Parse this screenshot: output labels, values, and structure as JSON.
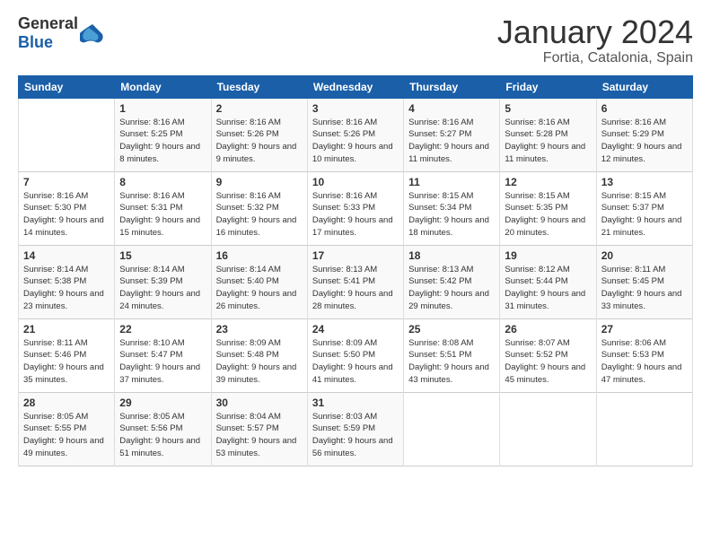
{
  "logo": {
    "general": "General",
    "blue": "Blue"
  },
  "header": {
    "month": "January 2024",
    "location": "Fortia, Catalonia, Spain"
  },
  "weekdays": [
    "Sunday",
    "Monday",
    "Tuesday",
    "Wednesday",
    "Thursday",
    "Friday",
    "Saturday"
  ],
  "weeks": [
    [
      {
        "day": "",
        "sunrise": "",
        "sunset": "",
        "daylight": ""
      },
      {
        "day": "1",
        "sunrise": "Sunrise: 8:16 AM",
        "sunset": "Sunset: 5:25 PM",
        "daylight": "Daylight: 9 hours and 8 minutes."
      },
      {
        "day": "2",
        "sunrise": "Sunrise: 8:16 AM",
        "sunset": "Sunset: 5:26 PM",
        "daylight": "Daylight: 9 hours and 9 minutes."
      },
      {
        "day": "3",
        "sunrise": "Sunrise: 8:16 AM",
        "sunset": "Sunset: 5:26 PM",
        "daylight": "Daylight: 9 hours and 10 minutes."
      },
      {
        "day": "4",
        "sunrise": "Sunrise: 8:16 AM",
        "sunset": "Sunset: 5:27 PM",
        "daylight": "Daylight: 9 hours and 11 minutes."
      },
      {
        "day": "5",
        "sunrise": "Sunrise: 8:16 AM",
        "sunset": "Sunset: 5:28 PM",
        "daylight": "Daylight: 9 hours and 11 minutes."
      },
      {
        "day": "6",
        "sunrise": "Sunrise: 8:16 AM",
        "sunset": "Sunset: 5:29 PM",
        "daylight": "Daylight: 9 hours and 12 minutes."
      }
    ],
    [
      {
        "day": "7",
        "sunrise": "Sunrise: 8:16 AM",
        "sunset": "Sunset: 5:30 PM",
        "daylight": "Daylight: 9 hours and 14 minutes."
      },
      {
        "day": "8",
        "sunrise": "Sunrise: 8:16 AM",
        "sunset": "Sunset: 5:31 PM",
        "daylight": "Daylight: 9 hours and 15 minutes."
      },
      {
        "day": "9",
        "sunrise": "Sunrise: 8:16 AM",
        "sunset": "Sunset: 5:32 PM",
        "daylight": "Daylight: 9 hours and 16 minutes."
      },
      {
        "day": "10",
        "sunrise": "Sunrise: 8:16 AM",
        "sunset": "Sunset: 5:33 PM",
        "daylight": "Daylight: 9 hours and 17 minutes."
      },
      {
        "day": "11",
        "sunrise": "Sunrise: 8:15 AM",
        "sunset": "Sunset: 5:34 PM",
        "daylight": "Daylight: 9 hours and 18 minutes."
      },
      {
        "day": "12",
        "sunrise": "Sunrise: 8:15 AM",
        "sunset": "Sunset: 5:35 PM",
        "daylight": "Daylight: 9 hours and 20 minutes."
      },
      {
        "day": "13",
        "sunrise": "Sunrise: 8:15 AM",
        "sunset": "Sunset: 5:37 PM",
        "daylight": "Daylight: 9 hours and 21 minutes."
      }
    ],
    [
      {
        "day": "14",
        "sunrise": "Sunrise: 8:14 AM",
        "sunset": "Sunset: 5:38 PM",
        "daylight": "Daylight: 9 hours and 23 minutes."
      },
      {
        "day": "15",
        "sunrise": "Sunrise: 8:14 AM",
        "sunset": "Sunset: 5:39 PM",
        "daylight": "Daylight: 9 hours and 24 minutes."
      },
      {
        "day": "16",
        "sunrise": "Sunrise: 8:14 AM",
        "sunset": "Sunset: 5:40 PM",
        "daylight": "Daylight: 9 hours and 26 minutes."
      },
      {
        "day": "17",
        "sunrise": "Sunrise: 8:13 AM",
        "sunset": "Sunset: 5:41 PM",
        "daylight": "Daylight: 9 hours and 28 minutes."
      },
      {
        "day": "18",
        "sunrise": "Sunrise: 8:13 AM",
        "sunset": "Sunset: 5:42 PM",
        "daylight": "Daylight: 9 hours and 29 minutes."
      },
      {
        "day": "19",
        "sunrise": "Sunrise: 8:12 AM",
        "sunset": "Sunset: 5:44 PM",
        "daylight": "Daylight: 9 hours and 31 minutes."
      },
      {
        "day": "20",
        "sunrise": "Sunrise: 8:11 AM",
        "sunset": "Sunset: 5:45 PM",
        "daylight": "Daylight: 9 hours and 33 minutes."
      }
    ],
    [
      {
        "day": "21",
        "sunrise": "Sunrise: 8:11 AM",
        "sunset": "Sunset: 5:46 PM",
        "daylight": "Daylight: 9 hours and 35 minutes."
      },
      {
        "day": "22",
        "sunrise": "Sunrise: 8:10 AM",
        "sunset": "Sunset: 5:47 PM",
        "daylight": "Daylight: 9 hours and 37 minutes."
      },
      {
        "day": "23",
        "sunrise": "Sunrise: 8:09 AM",
        "sunset": "Sunset: 5:48 PM",
        "daylight": "Daylight: 9 hours and 39 minutes."
      },
      {
        "day": "24",
        "sunrise": "Sunrise: 8:09 AM",
        "sunset": "Sunset: 5:50 PM",
        "daylight": "Daylight: 9 hours and 41 minutes."
      },
      {
        "day": "25",
        "sunrise": "Sunrise: 8:08 AM",
        "sunset": "Sunset: 5:51 PM",
        "daylight": "Daylight: 9 hours and 43 minutes."
      },
      {
        "day": "26",
        "sunrise": "Sunrise: 8:07 AM",
        "sunset": "Sunset: 5:52 PM",
        "daylight": "Daylight: 9 hours and 45 minutes."
      },
      {
        "day": "27",
        "sunrise": "Sunrise: 8:06 AM",
        "sunset": "Sunset: 5:53 PM",
        "daylight": "Daylight: 9 hours and 47 minutes."
      }
    ],
    [
      {
        "day": "28",
        "sunrise": "Sunrise: 8:05 AM",
        "sunset": "Sunset: 5:55 PM",
        "daylight": "Daylight: 9 hours and 49 minutes."
      },
      {
        "day": "29",
        "sunrise": "Sunrise: 8:05 AM",
        "sunset": "Sunset: 5:56 PM",
        "daylight": "Daylight: 9 hours and 51 minutes."
      },
      {
        "day": "30",
        "sunrise": "Sunrise: 8:04 AM",
        "sunset": "Sunset: 5:57 PM",
        "daylight": "Daylight: 9 hours and 53 minutes."
      },
      {
        "day": "31",
        "sunrise": "Sunrise: 8:03 AM",
        "sunset": "Sunset: 5:59 PM",
        "daylight": "Daylight: 9 hours and 56 minutes."
      },
      {
        "day": "",
        "sunrise": "",
        "sunset": "",
        "daylight": ""
      },
      {
        "day": "",
        "sunrise": "",
        "sunset": "",
        "daylight": ""
      },
      {
        "day": "",
        "sunrise": "",
        "sunset": "",
        "daylight": ""
      }
    ]
  ]
}
